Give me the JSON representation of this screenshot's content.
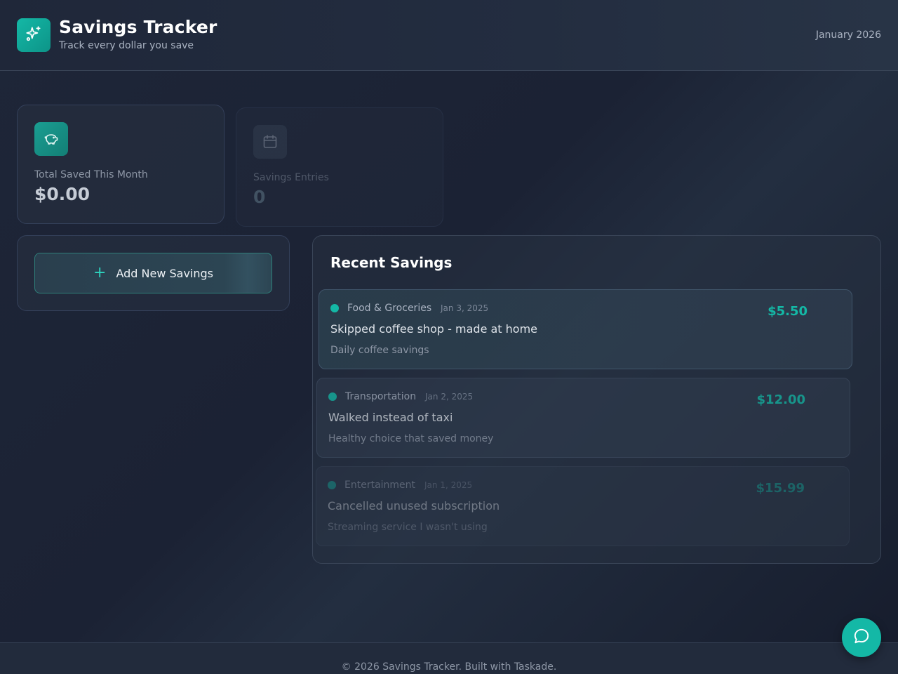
{
  "header": {
    "title": "Savings Tracker",
    "subtitle": "Track every dollar you save",
    "month": "January 2026",
    "logo_icon": "sparkles-icon"
  },
  "stats": [
    {
      "label": "Total Saved This Month",
      "value": "$0.00",
      "icon": "piggy-bank-icon"
    },
    {
      "label": "Savings Entries",
      "value": "0",
      "icon": "calendar-icon"
    }
  ],
  "add_button": {
    "label": "Add New Savings",
    "icon": "plus-icon"
  },
  "recent": {
    "title": "Recent Savings",
    "entries": [
      {
        "category": "Food & Groceries",
        "date": "Jan 3, 2025",
        "title": "Skipped coffee shop - made at home",
        "note": "Daily coffee savings",
        "amount": "$5.50"
      },
      {
        "category": "Transportation",
        "date": "Jan 2, 2025",
        "title": "Walked instead of taxi",
        "note": "Healthy choice that saved money",
        "amount": "$12.00"
      },
      {
        "category": "Entertainment",
        "date": "Jan 1, 2025",
        "title": "Cancelled unused subscription",
        "note": "Streaming service I wasn't using",
        "amount": "$15.99"
      }
    ]
  },
  "footer": {
    "text": "© 2026 Savings Tracker. Built with Taskade."
  },
  "colors": {
    "accent": "#14b8a6",
    "background": "#1b2234",
    "card": "#283242"
  },
  "chat_button": {
    "icon": "chat-bubble-icon"
  }
}
